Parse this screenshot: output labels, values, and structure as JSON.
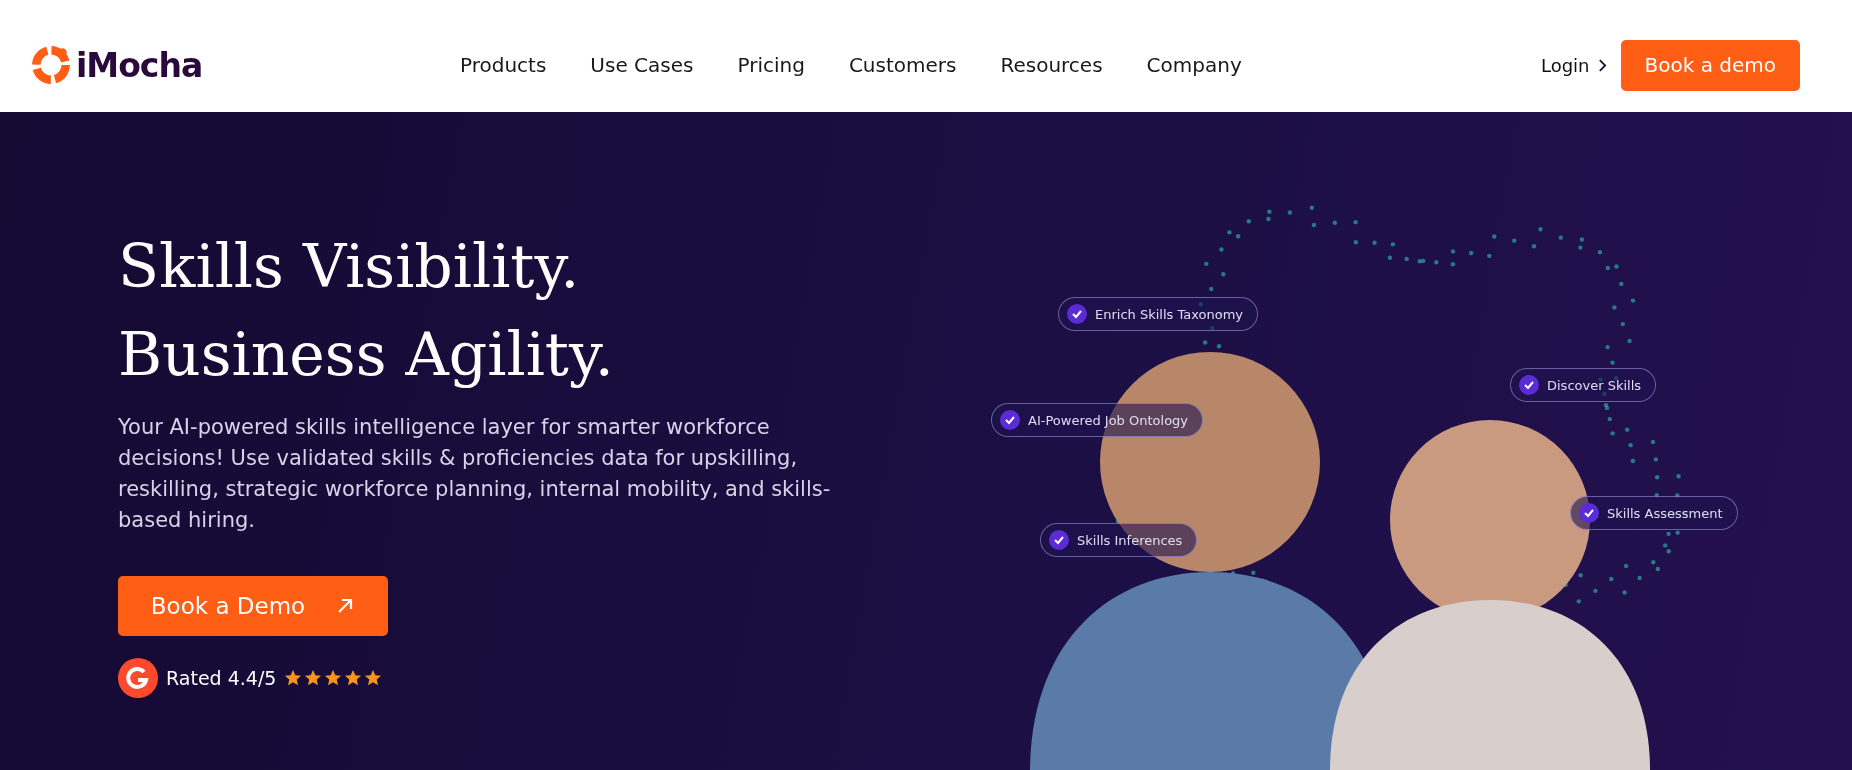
{
  "header": {
    "logo": "iMocha",
    "nav": [
      "Products",
      "Use Cases",
      "Pricing",
      "Customers",
      "Resources",
      "Company"
    ],
    "login": "Login",
    "cta": "Book a demo"
  },
  "hero": {
    "title_lines": [
      "Skills Visibility.",
      "Business Agility."
    ],
    "description": "Your AI-powered skills intelligence layer for smarter workforce decisions! Use validated skills & proficiencies data for upskilling, reskilling, strategic workforce planning, internal mobility, and skills-based hiring.",
    "cta": "Book a Demo",
    "rating": {
      "text": "Rated 4.4/5",
      "stars": 5
    }
  },
  "feature_tags": [
    "Enrich Skills Taxonomy",
    "AI-Powered Job Ontology",
    "Skills Inferences",
    "Discover Skills",
    "Skills Assessment"
  ]
}
